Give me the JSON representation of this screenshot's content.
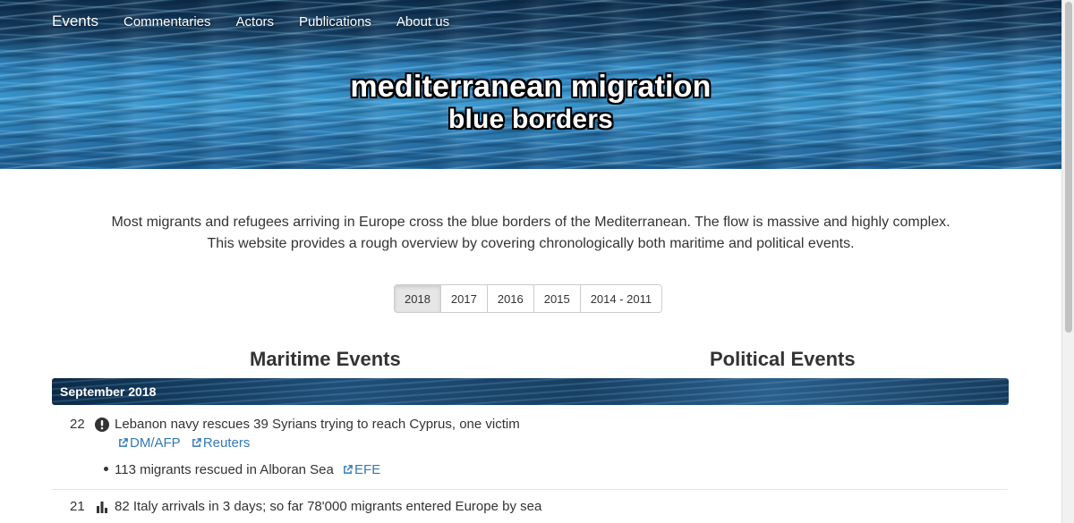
{
  "nav": {
    "brand": "Events",
    "items": [
      "Commentaries",
      "Actors",
      "Publications",
      "About us"
    ]
  },
  "header": {
    "title_line1": "mediterranean migration",
    "title_line2": "blue borders"
  },
  "intro": {
    "line1": "Most migrants and refugees arriving in Europe cross the blue borders of the Mediterranean. The flow is massive and highly complex.",
    "line2": "This website provides a rough overview by covering chronologically both maritime and political events."
  },
  "years": {
    "selected": "2018",
    "options": [
      "2018",
      "2017",
      "2016",
      "2015",
      "2014 - 2011"
    ]
  },
  "columns": {
    "maritime": "Maritime Events",
    "political": "Political Events"
  },
  "month": "September 2018",
  "events": [
    {
      "day": "22",
      "icon": "exclamation-circle-icon",
      "text": "Lebanon navy rescues 39 Syrians trying to reach Cyprus, one victim",
      "links": [
        "DM/AFP",
        "Reuters"
      ]
    },
    {
      "day": "21",
      "icon": "bar-chart-icon",
      "text": "82 Italy arrivals in 3 days; so far 78'000 migrants entered Europe by sea"
    }
  ],
  "bullets": [
    {
      "text": "113 migrants rescued in Alboran Sea",
      "links": [
        "EFE"
      ]
    }
  ],
  "colors": {
    "link": "#337ab7",
    "text": "#333333"
  }
}
